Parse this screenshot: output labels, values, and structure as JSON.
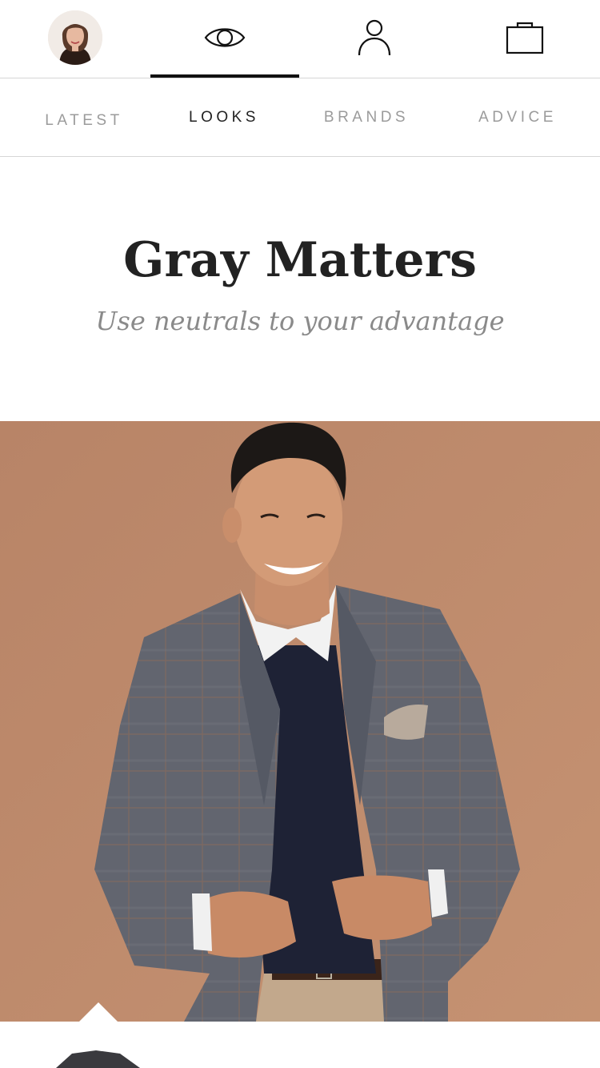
{
  "topnav": {
    "icons": [
      "avatar",
      "eye-icon",
      "person-icon",
      "shopping-bag-icon"
    ],
    "active": "eye-icon"
  },
  "tabs": [
    {
      "label": "LATEST",
      "active": false
    },
    {
      "label": "LOOKS",
      "active": true
    },
    {
      "label": "BRANDS",
      "active": false
    },
    {
      "label": "ADVICE",
      "active": false
    }
  ],
  "article": {
    "title": "Gray Matters",
    "subtitle": "Use neutrals to your advantage"
  },
  "colors": {
    "accent": "#111111",
    "tab_inactive": "#9b9b9b",
    "hero_background": "#b9866a"
  }
}
